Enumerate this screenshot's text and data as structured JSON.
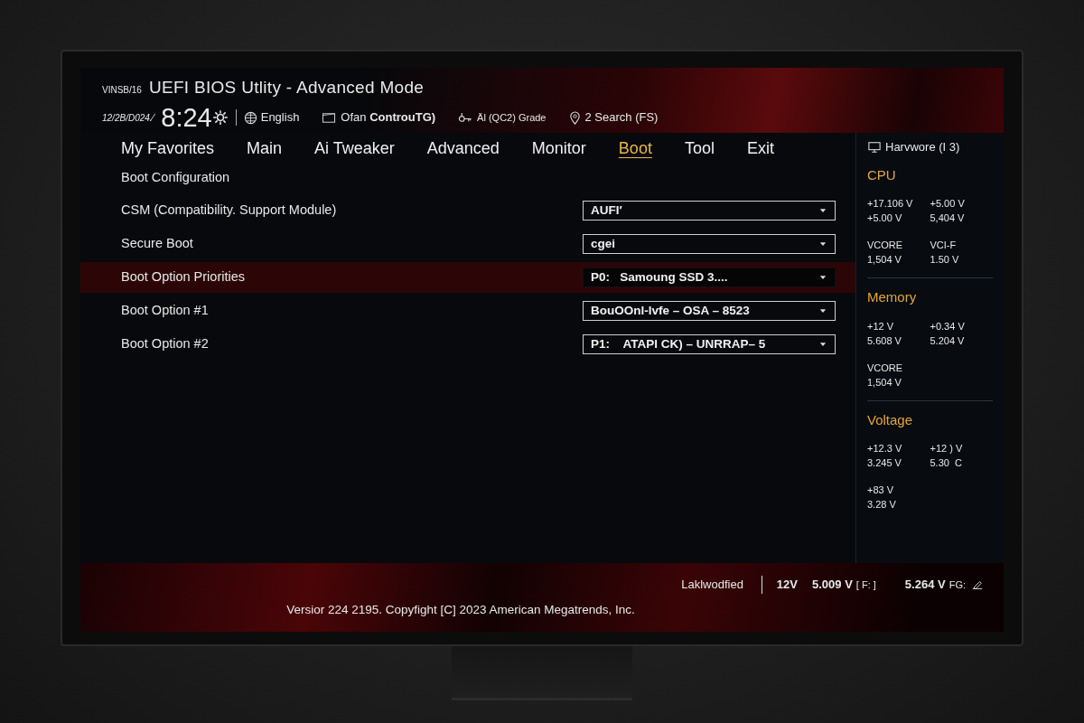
{
  "header": {
    "model": "VINSB/16",
    "title": "UEFI BIOS Utlity - Advanced Mode",
    "date": "12/2B/D024.⁄",
    "time": "8:24",
    "tools": [
      {
        "kind": "globe",
        "label": "English"
      },
      {
        "kind": "fan",
        "label": "Ofan **ControuTG)**"
      },
      {
        "kind": "key",
        "label": "Äl (QC2) Grade"
      },
      {
        "kind": "pin",
        "label": "2 Search (FS)"
      }
    ]
  },
  "tabs": [
    {
      "label": "My Favorites",
      "selected": false
    },
    {
      "label": "Main",
      "selected": false
    },
    {
      "label": "Ai Tweaker",
      "selected": false
    },
    {
      "label": "Advanced",
      "selected": false
    },
    {
      "label": "Monitor",
      "selected": false
    },
    {
      "label": "Boot",
      "selected": true
    },
    {
      "label": "Tool",
      "selected": false
    },
    {
      "label": "Exit",
      "selected": false
    }
  ],
  "section_title": "Boot Configuration",
  "settings": [
    {
      "label": "CSM (Compatibility. Support Module)",
      "value": "AUFI′",
      "selected": false
    },
    {
      "label": "Secure Boot",
      "value": "cgei",
      "selected": false
    },
    {
      "label": "Boot Option Priorities",
      "value": "P0:   Samoung SSD 3....",
      "selected": true
    },
    {
      "label": "Boot Option #1",
      "value": "BouOOnl-lvfe – OSA – 8523",
      "selected": false
    },
    {
      "label": "Boot Option #2",
      "value": "P1:    ATAPI CK) – UNRRAP– 5",
      "selected": false
    }
  ],
  "sidebar": {
    "title": "Harvwore (I 3)",
    "sections": [
      {
        "title": "CPU",
        "groups": [
          [
            [
              "+17.106 V",
              "+5.00 V"
            ],
            [
              "+5.00 V",
              "5,404 V"
            ]
          ],
          [
            [
              "VCORE",
              "1,504 V"
            ],
            [
              "VCI-F",
              "1.50 V"
            ]
          ]
        ]
      },
      {
        "title": "Memory",
        "groups": [
          [
            [
              "+12 V",
              "5.608 V"
            ],
            [
              "+0.34 V",
              "5.204 V"
            ]
          ],
          [
            [
              "VCORE",
              "1,504 V"
            ]
          ]
        ]
      },
      {
        "title": "Voltage",
        "groups": [
          [
            [
              "+12.3 V",
              "3.245 V"
            ],
            [
              "+12 ) V",
              "5.30  C"
            ]
          ],
          [
            [
              "+83 V",
              "3.28 V"
            ]
          ]
        ]
      }
    ]
  },
  "footer": {
    "status": "Laklwodfied",
    "rail": "12V",
    "readings": [
      {
        "value": "5.009 V",
        "tag": "[ F: ]"
      },
      {
        "value": "5.264 V",
        "tag": "FG:"
      }
    ],
    "version": "Versior 224 2195. Copyfight [C] 2023 American Megatrends, Inc."
  }
}
